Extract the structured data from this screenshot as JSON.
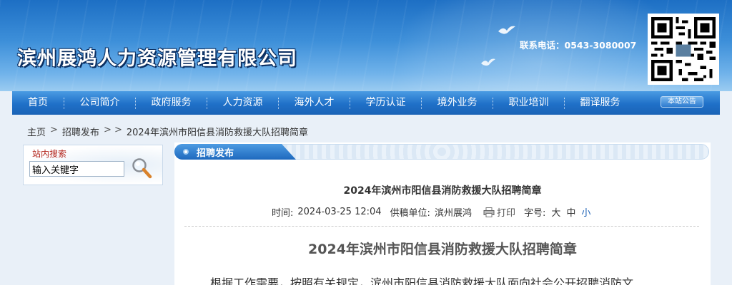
{
  "header": {
    "company_name": "滨州展鸿人力资源管理有限公司",
    "contact": "联系电话：0543-3080007"
  },
  "nav": {
    "items": [
      "首页",
      "公司简介",
      "政府服务",
      "人力资源",
      "海外人才",
      "学历认证",
      "境外业务",
      "职业培训",
      "翻译服务"
    ],
    "notice_label": "本站公告"
  },
  "breadcrumb": {
    "home": "主页",
    "sep1": ">",
    "section": "招聘发布",
    "sep2": "> >",
    "current": "2024年滨州市阳信县消防救援大队招聘简章"
  },
  "search": {
    "title": "站内搜索",
    "value": "输入关键字"
  },
  "panel": {
    "tab_label": "招聘发布"
  },
  "article": {
    "title": "2024年滨州市阳信县消防救援大队招聘简章",
    "time_label": "时间:",
    "time_value": "2024-03-25 12:04",
    "source_label": "供稿单位:",
    "source_value": "滨州展鸿",
    "print_label": "打印",
    "font_label": "字号:",
    "font_large": "大",
    "font_medium": "中",
    "font_small": "小",
    "body_title": "2024年滨州市阳信县消防救援大队招聘简章",
    "body_text": "根据工作需要，按照有关规定，滨州市阳信县消防救援大队面向社会公开招聘消防文"
  },
  "colors": {
    "nav_blue": "#1f70c8",
    "accent_red": "#b3261e",
    "link_blue": "#1a5fb4"
  }
}
